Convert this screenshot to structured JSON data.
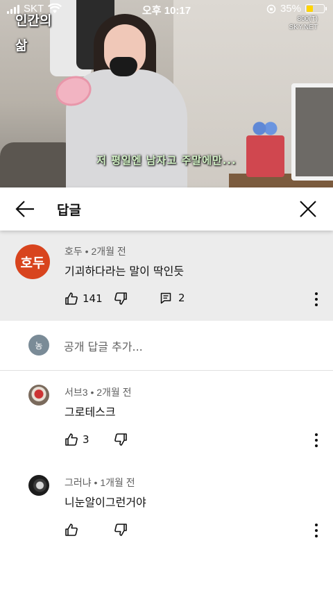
{
  "status_bar": {
    "carrier": "SKT",
    "time": "오후 10:17",
    "battery": "35%",
    "battery_level": 0.35
  },
  "video": {
    "channel_logo": "인간의 삶",
    "watermark_line1": "800(T)",
    "watermark_line2": "SKY.NET",
    "subtitle": "저 평일엔 남자고 주말에만..."
  },
  "header": {
    "title": "답글"
  },
  "parent_comment": {
    "avatar_text": "호두",
    "avatar_color": "#d8441e",
    "author": "호두",
    "time": "2개월 전",
    "text": "기괴하다라는 말이 딱인듯",
    "likes": "141",
    "replies": "2"
  },
  "add_reply": {
    "avatar_text": "농",
    "avatar_color": "#7a8b97",
    "placeholder": "공개 답글 추가..."
  },
  "replies": [
    {
      "author": "서브3",
      "time": "2개월 전",
      "text": "그로테스크",
      "likes": "3"
    },
    {
      "author": "그러냐",
      "time": "1개월 전",
      "text": "니눈알이그런거야",
      "likes": ""
    }
  ]
}
